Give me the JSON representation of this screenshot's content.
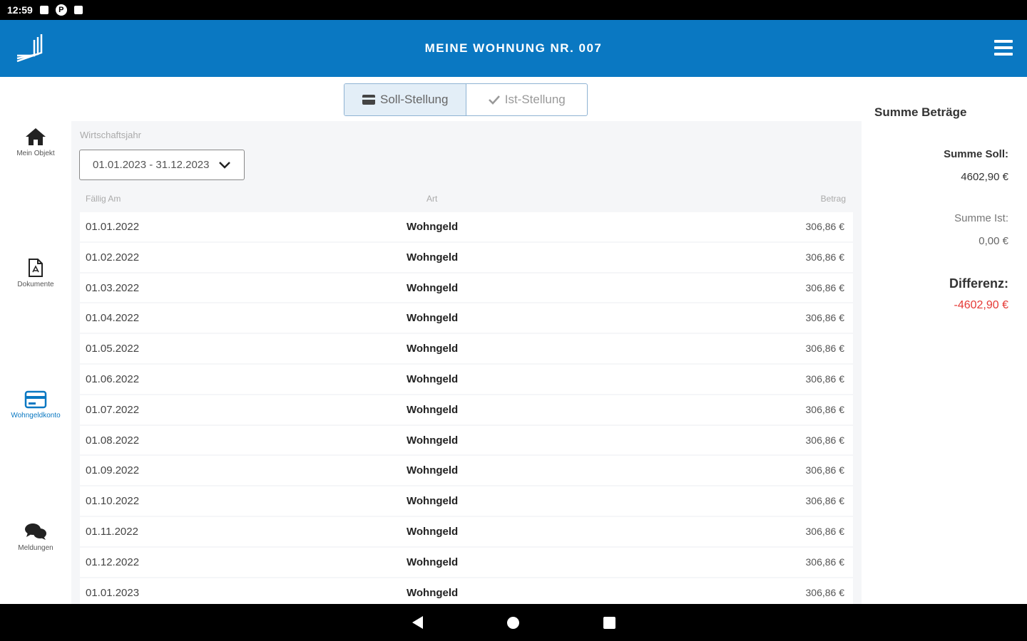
{
  "status_bar": {
    "time": "12:59",
    "icon_p": "P"
  },
  "app_bar": {
    "title": "MEINE WOHNUNG NR. 007"
  },
  "nav": {
    "items": [
      {
        "label": "Mein Objekt"
      },
      {
        "label": "Dokumente"
      },
      {
        "label": "Wohngeldkonto"
      },
      {
        "label": "Meldungen"
      }
    ]
  },
  "toggle": {
    "soll_label": "Soll-Stellung",
    "ist_label": "Ist-Stellung"
  },
  "filter": {
    "label": "Wirtschaftsjahr",
    "value": "01.01.2023 - 31.12.2023"
  },
  "table": {
    "headers": [
      "Fällig Am",
      "Art",
      "Betrag"
    ],
    "rows": [
      {
        "date": "01.01.2022",
        "art": "Wohngeld",
        "betrag": "306,86 €"
      },
      {
        "date": "01.02.2022",
        "art": "Wohngeld",
        "betrag": "306,86 €"
      },
      {
        "date": "01.03.2022",
        "art": "Wohngeld",
        "betrag": "306,86 €"
      },
      {
        "date": "01.04.2022",
        "art": "Wohngeld",
        "betrag": "306,86 €"
      },
      {
        "date": "01.05.2022",
        "art": "Wohngeld",
        "betrag": "306,86 €"
      },
      {
        "date": "01.06.2022",
        "art": "Wohngeld",
        "betrag": "306,86 €"
      },
      {
        "date": "01.07.2022",
        "art": "Wohngeld",
        "betrag": "306,86 €"
      },
      {
        "date": "01.08.2022",
        "art": "Wohngeld",
        "betrag": "306,86 €"
      },
      {
        "date": "01.09.2022",
        "art": "Wohngeld",
        "betrag": "306,86 €"
      },
      {
        "date": "01.10.2022",
        "art": "Wohngeld",
        "betrag": "306,86 €"
      },
      {
        "date": "01.11.2022",
        "art": "Wohngeld",
        "betrag": "306,86 €"
      },
      {
        "date": "01.12.2022",
        "art": "Wohngeld",
        "betrag": "306,86 €"
      },
      {
        "date": "01.01.2023",
        "art": "Wohngeld",
        "betrag": "306,86 €"
      }
    ]
  },
  "summary": {
    "title": "Summe Beträge",
    "soll_label": "Summe Soll:",
    "soll_value": "4602,90 €",
    "ist_label": "Summe Ist:",
    "ist_value": "0,00 €",
    "diff_label": "Differenz:",
    "diff_value": "-4602,90 €",
    "negative_color": "#e53935"
  },
  "colors": {
    "brand": "#0a78c2"
  }
}
